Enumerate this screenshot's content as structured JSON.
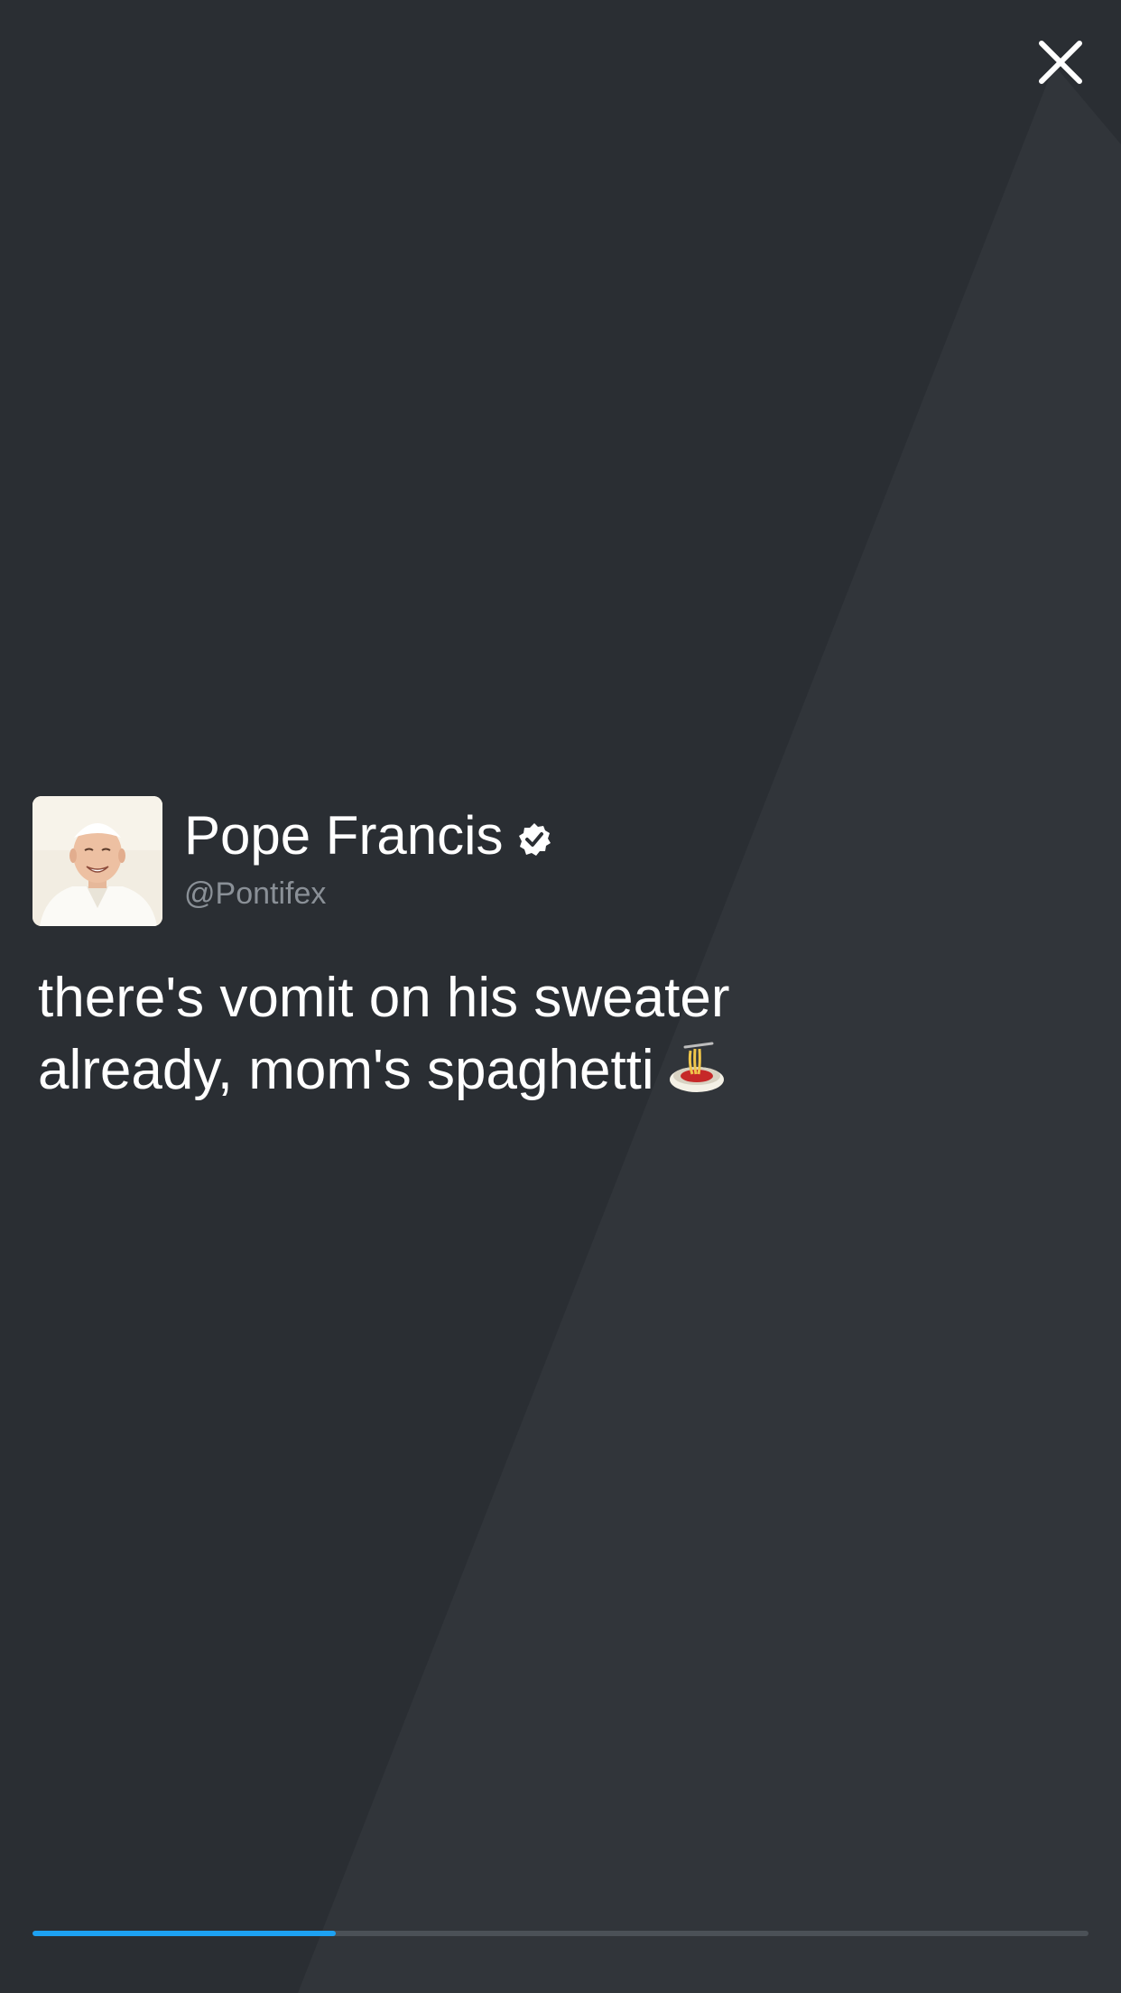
{
  "user": {
    "name": "Pope Francis",
    "handle": "@Pontifex",
    "verified": true
  },
  "tweet": {
    "lines": [
      "there's vomit on his sweater",
      "already, mom's spaghetti"
    ],
    "emoji": "spaghetti-emoji"
  },
  "progress": {
    "fraction": 0.287
  },
  "icons": {
    "close": "close-icon",
    "verified": "verified-badge-icon"
  },
  "colors": {
    "background": "#2a2e33",
    "accent": "#1da1f2",
    "track": "#4b5157",
    "handle": "#8a9097"
  }
}
